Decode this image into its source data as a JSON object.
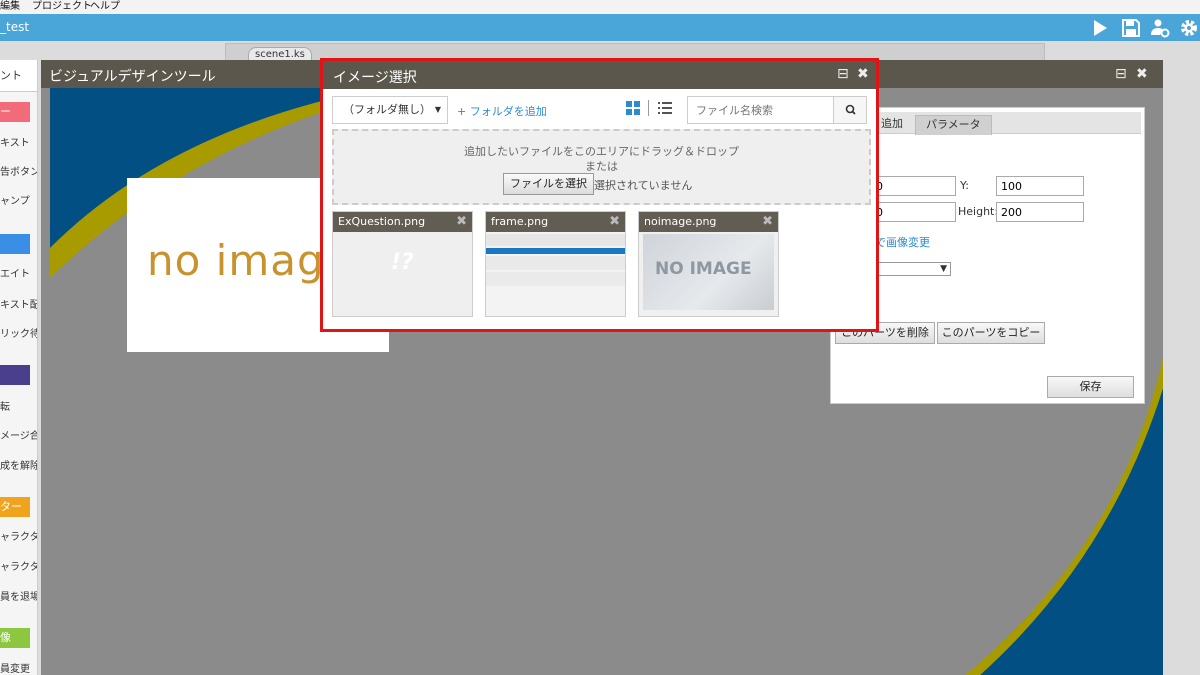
{
  "menubar": {
    "items": [
      "編集",
      "プロジェクト",
      "ヘルプ"
    ]
  },
  "appbar": {
    "title": "_test",
    "icons": [
      "play-icon",
      "save-icon",
      "users-gear-icon",
      "gear-icon"
    ]
  },
  "editor": {
    "scene_tab": "scene1.ks"
  },
  "toolbox": {
    "tab_label": "ント",
    "categories": [
      {
        "label": "ー",
        "color": "#f26b7a"
      },
      {
        "label": "",
        "color": "#3a8ee6"
      },
      {
        "label": "",
        "color": "#4a3f8c"
      },
      {
        "label": "ター",
        "color": "#f0a31c"
      },
      {
        "label": "像",
        "color": "#8dc63f"
      }
    ],
    "items": [
      "キスト",
      "告ボタン",
      "ャンプ",
      "エイト",
      "キスト配置",
      "リック待ち",
      "転",
      "メージ合成",
      "成を解除",
      "ャラクター",
      "ャラクター",
      "員を退場",
      "員変更"
    ]
  },
  "visual_designer": {
    "title": "ビジュアルデザインツール",
    "canvas_colors": {
      "stripe": "#014f83",
      "arc": "#a79b00"
    },
    "noimage_text": "no image"
  },
  "properties": {
    "tabs": [
      "追加",
      "パラメータ"
    ],
    "x_value": "0",
    "y_label": "Y:",
    "y_value": "100",
    "w_value": "0",
    "height_label": "Height:",
    "height_value": "200",
    "change_image_link": "で画像変更",
    "delete_button": "このパーツを削除",
    "copy_button": "このパーツをコピー",
    "save_button": "保存"
  },
  "dialog": {
    "title": "イメージ選択",
    "folder_select": "（フォルダ無し）",
    "add_folder": "+ フォルダを追加",
    "search_placeholder": "ファイル名検索",
    "drop_text": "追加したいファイルをこのエリアにドラッグ＆ドロップ",
    "or_text": "または",
    "choose_file": "ファイルを選択",
    "no_file": "選択されていません",
    "highlight_color": "#e01414",
    "files": [
      {
        "name": "ExQuestion.png",
        "preview_text": "!?"
      },
      {
        "name": "frame.png",
        "preview_text": ""
      },
      {
        "name": "noimage.png",
        "preview_text": "NO IMAGE"
      }
    ]
  }
}
